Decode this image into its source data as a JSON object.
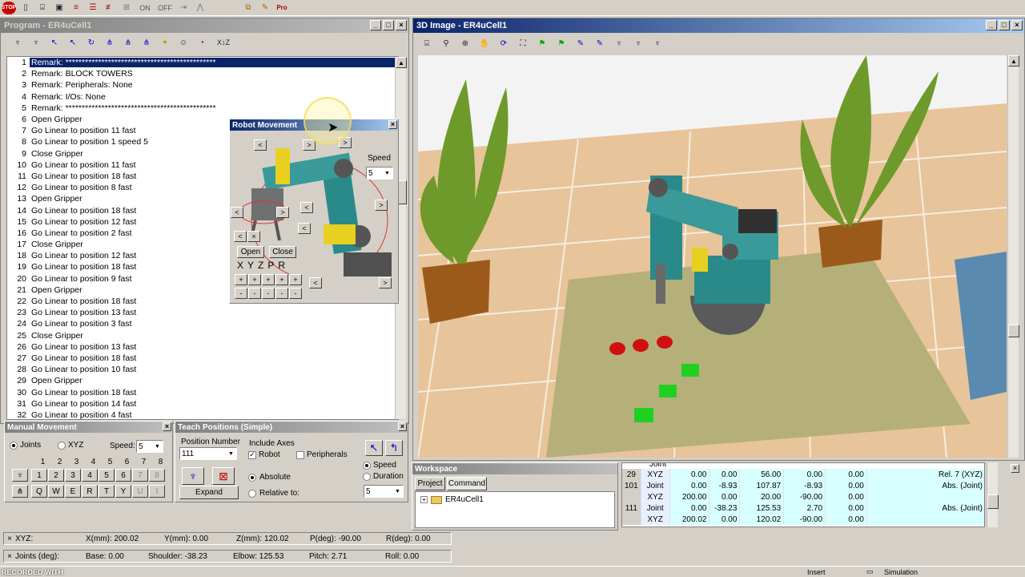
{
  "toolbar": {
    "stop_label": "STOP",
    "on_label": "ON",
    "off_label": "OFF"
  },
  "program_window": {
    "title": "Program - ER4uCell1",
    "tools": {
      "xyz_label": "X↕Z"
    },
    "lines": [
      {
        "n": "1",
        "text": "Remark:  **********************************************"
      },
      {
        "n": "2",
        "text": "Remark:  BLOCK TOWERS"
      },
      {
        "n": "3",
        "text": "Remark:  Peripherals: None"
      },
      {
        "n": "4",
        "text": "Remark:  I/Os: None"
      },
      {
        "n": "5",
        "text": "Remark:  **********************************************"
      },
      {
        "n": "6",
        "text": "Open Gripper"
      },
      {
        "n": "7",
        "text": "Go Linear to position  11  fast"
      },
      {
        "n": "8",
        "text": "Go Linear to position  1  speed  5"
      },
      {
        "n": "9",
        "text": "Close Gripper"
      },
      {
        "n": "10",
        "text": "Go Linear to position  11  fast"
      },
      {
        "n": "11",
        "text": "Go Linear to position  18  fast"
      },
      {
        "n": "12",
        "text": "Go Linear to position  8  fast"
      },
      {
        "n": "13",
        "text": "Open Gripper"
      },
      {
        "n": "14",
        "text": "Go Linear to position  18  fast"
      },
      {
        "n": "15",
        "text": "Go Linear to position  12  fast"
      },
      {
        "n": "16",
        "text": "Go Linear to position  2  fast"
      },
      {
        "n": "17",
        "text": "Close Gripper"
      },
      {
        "n": "18",
        "text": "Go Linear to position  12  fast"
      },
      {
        "n": "19",
        "text": "Go Linear to position  18  fast"
      },
      {
        "n": "20",
        "text": "Go Linear to position  9  fast"
      },
      {
        "n": "21",
        "text": "Open Gripper"
      },
      {
        "n": "22",
        "text": "Go Linear to position  18  fast"
      },
      {
        "n": "23",
        "text": "Go Linear to position  13  fast"
      },
      {
        "n": "24",
        "text": "Go Linear to position  3  fast"
      },
      {
        "n": "25",
        "text": "Close Gripper"
      },
      {
        "n": "26",
        "text": "Go Linear to position  13  fast"
      },
      {
        "n": "27",
        "text": "Go Linear to position  18  fast"
      },
      {
        "n": "28",
        "text": "Go Linear to position  10  fast"
      },
      {
        "n": "29",
        "text": "Open Gripper"
      },
      {
        "n": "30",
        "text": "Go Linear to position  18  fast"
      },
      {
        "n": "31",
        "text": "Go Linear to position  14  fast"
      },
      {
        "n": "32",
        "text": "Go Linear to position  4  fast"
      }
    ]
  },
  "robot_movement": {
    "title": "Robot Movement",
    "speed_label": "Speed",
    "speed_value": "5",
    "open_label": "Open",
    "close_label": "Close",
    "axes": [
      "X",
      "Y",
      "Z",
      "P",
      "R"
    ]
  },
  "manual_movement": {
    "title": "Manual Movement",
    "joints_label": "Joints",
    "xyz_label": "XYZ",
    "speed_label": "Speed:",
    "speed_value": "5",
    "numbers": [
      "1",
      "2",
      "3",
      "4",
      "5",
      "6",
      "7",
      "8"
    ],
    "plus_keys": [
      "1",
      "2",
      "3",
      "4",
      "5",
      "6",
      "7",
      "8"
    ],
    "minus_keys": [
      "Q",
      "W",
      "E",
      "R",
      "T",
      "Y",
      "U",
      "I"
    ]
  },
  "teach_positions": {
    "title": "Teach Positions (Simple)",
    "position_number_label": "Position Number",
    "position_value": "111",
    "include_axes_label": "Include Axes",
    "robot_label": "Robot",
    "peripherals_label": "Peripherals",
    "absolute_label": "Absolute",
    "relative_label": "Relative to:",
    "expand_label": "Expand",
    "speed_label": "Speed",
    "duration_label": "Duration",
    "speed_value": "5"
  },
  "image_window": {
    "title": "3D Image - ER4uCell1"
  },
  "workspace": {
    "title": "Workspace",
    "tab_project": "Project",
    "tab_command": "Command",
    "tree_item": "ER4uCell1"
  },
  "positions_table": {
    "partial_row": "Joint",
    "rows": [
      {
        "id": "29",
        "type": "XYZ",
        "v1": "0.00",
        "v2": "0.00",
        "v3": "56.00",
        "v4": "0.00",
        "v5": "0.00",
        "note": "Rel. 7 (XYZ)"
      },
      {
        "id": "101",
        "type": "Joint",
        "v1": "0.00",
        "v2": "-8.93",
        "v3": "107.87",
        "v4": "-8.93",
        "v5": "0.00",
        "note": "Abs. (Joint)"
      },
      {
        "id": "",
        "type": "XYZ",
        "v1": "200.00",
        "v2": "0.00",
        "v3": "20.00",
        "v4": "-90.00",
        "v5": "0.00",
        "note": ""
      },
      {
        "id": "111",
        "type": "Joint",
        "v1": "0.00",
        "v2": "-38.23",
        "v3": "125.53",
        "v4": "2.70",
        "v5": "0.00",
        "note": "Abs. (Joint)"
      },
      {
        "id": "",
        "type": "XYZ",
        "v1": "200.02",
        "v2": "0.00",
        "v3": "120.02",
        "v4": "-90.00",
        "v5": "0.00",
        "note": ""
      }
    ]
  },
  "status_xyz": {
    "label": "XYZ:",
    "x": "X(mm):  200.02",
    "y": "Y(mm):    0.00",
    "z": "Z(mm):  120.02",
    "p": "P(deg):  -90.00",
    "r": "R(deg):    0.00"
  },
  "status_joints": {
    "label": "Joints (deg):",
    "base": "Base:    0.00",
    "shoulder": "Shoulder:  -38.23",
    "elbow": "Elbow:  125.53",
    "pitch": "Pitch:    2.71",
    "roll": "Roll:    0.00"
  },
  "bottom_bar": {
    "recorded": "RECORDED WITH",
    "insert": "Insert",
    "simulation": "Simulation"
  }
}
